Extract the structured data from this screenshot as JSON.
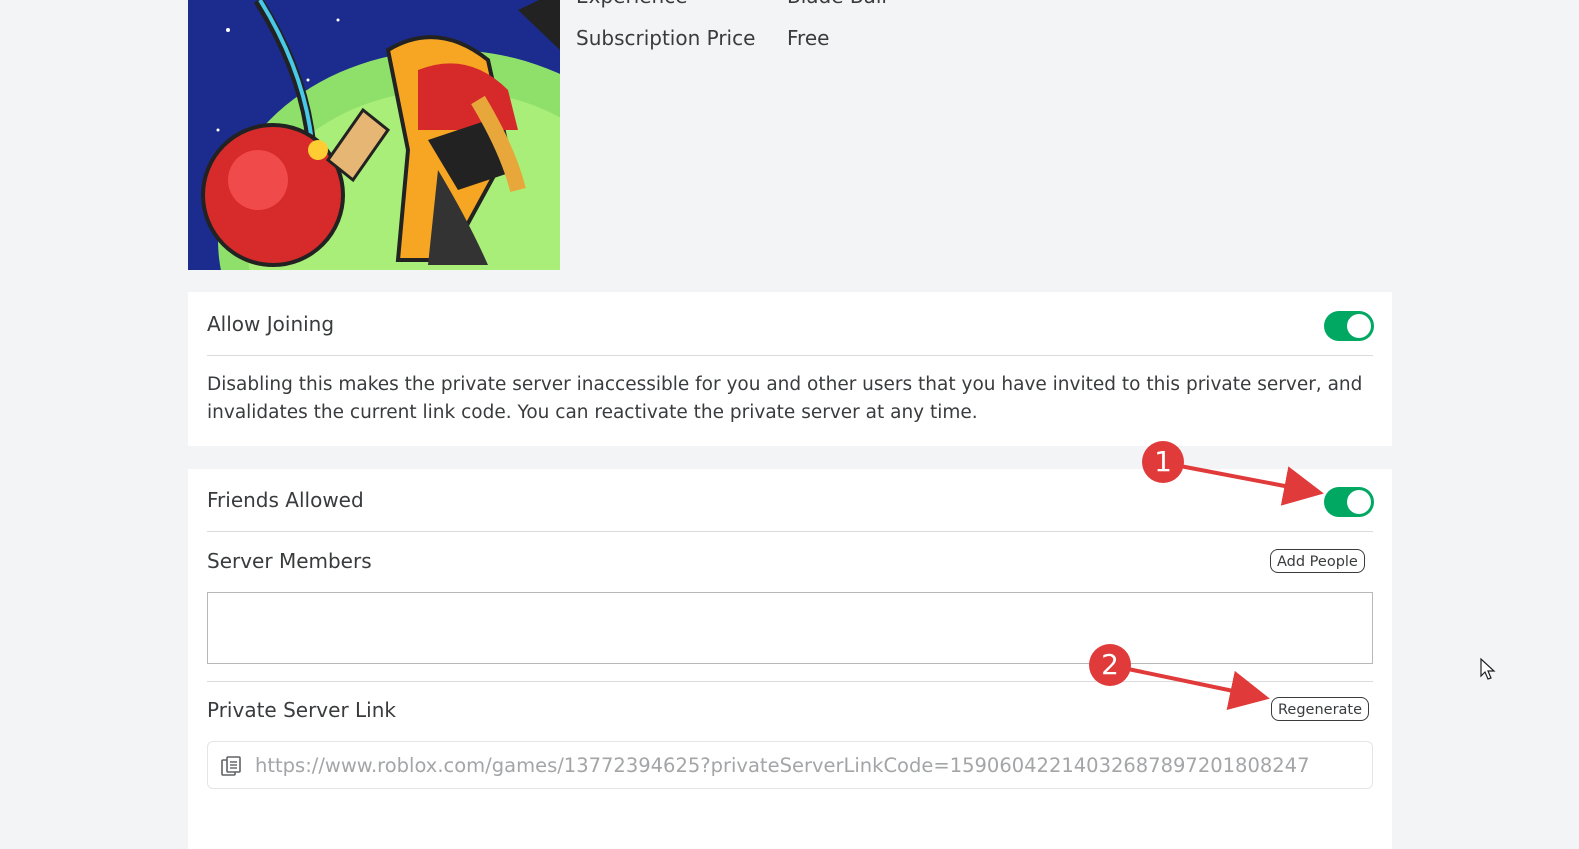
{
  "info": {
    "experience_label": "Experience",
    "experience_value": "Blade Ball",
    "subscription_label": "Subscription Price",
    "subscription_value": "Free"
  },
  "allow_joining": {
    "title": "Allow Joining",
    "enabled": true,
    "description": "Disabling this makes the private server inaccessible for you and other users that you have invited to this private server, and invalidates the current link code. You can reactivate the private server at any time."
  },
  "friends_allowed": {
    "title": "Friends Allowed",
    "enabled": true
  },
  "server_members": {
    "title": "Server Members",
    "add_button": "Add People"
  },
  "private_link": {
    "title": "Private Server Link",
    "regenerate_button": "Regenerate",
    "url": "https://www.roblox.com/games/13772394625?privateServerLinkCode=15906042214032687897201808247"
  },
  "annotations": {
    "marker_1": "1",
    "marker_2": "2"
  },
  "colors": {
    "toggle_on": "#00a862",
    "annotation_red": "#e03a3a",
    "page_bg": "#f2f4f5"
  }
}
